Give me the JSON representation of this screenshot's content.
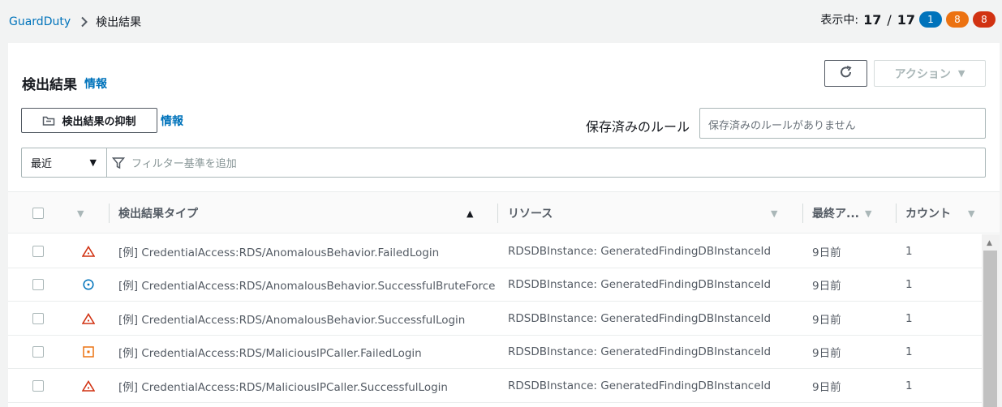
{
  "breadcrumb": {
    "root": "GuardDuty",
    "current": "検出結果"
  },
  "counter": {
    "label": "表示中:",
    "shown": "17",
    "total": "17",
    "badges": [
      {
        "value": "1",
        "color": "#0073bb"
      },
      {
        "value": "8",
        "color": "#ec7211"
      },
      {
        "value": "8",
        "color": "#d13212"
      }
    ]
  },
  "header": {
    "title": "検出結果",
    "info": "情報",
    "action_label": "アクション"
  },
  "toolbar": {
    "suppress_label": "検出結果の抑制",
    "info": "情報",
    "saved_rules_label": "保存済みのルール",
    "saved_rules_placeholder": "保存済みのルールがありません"
  },
  "filter": {
    "time_value": "最近",
    "placeholder": "フィルター基準を追加"
  },
  "columns": {
    "type": "検出結果タイプ",
    "resource": "リソース",
    "last": "最終ア...",
    "count": "カウント"
  },
  "rows": [
    {
      "severity": "high",
      "type": "[例] CredentialAccess:RDS/AnomalousBehavior.FailedLogin",
      "resource": "RDSDBInstance: GeneratedFindingDBInstanceId",
      "last": "9日前",
      "count": "1"
    },
    {
      "severity": "low",
      "type": "[例] CredentialAccess:RDS/AnomalousBehavior.SuccessfulBruteForce",
      "resource": "RDSDBInstance: GeneratedFindingDBInstanceId",
      "last": "9日前",
      "count": "1"
    },
    {
      "severity": "high",
      "type": "[例] CredentialAccess:RDS/AnomalousBehavior.SuccessfulLogin",
      "resource": "RDSDBInstance: GeneratedFindingDBInstanceId",
      "last": "9日前",
      "count": "1"
    },
    {
      "severity": "medium",
      "type": "[例] CredentialAccess:RDS/MaliciousIPCaller.FailedLogin",
      "resource": "RDSDBInstance: GeneratedFindingDBInstanceId",
      "last": "9日前",
      "count": "1"
    },
    {
      "severity": "high",
      "type": "[例] CredentialAccess:RDS/MaliciousIPCaller.SuccessfulLogin",
      "resource": "RDSDBInstance: GeneratedFindingDBInstanceId",
      "last": "9日前",
      "count": "1"
    }
  ],
  "icons": {
    "high": "triangle-warning-icon",
    "medium": "square-dot-icon",
    "low": "circle-dot-icon"
  },
  "severity_colors": {
    "high": "#d13212",
    "medium": "#ec7211",
    "low": "#0073bb"
  }
}
